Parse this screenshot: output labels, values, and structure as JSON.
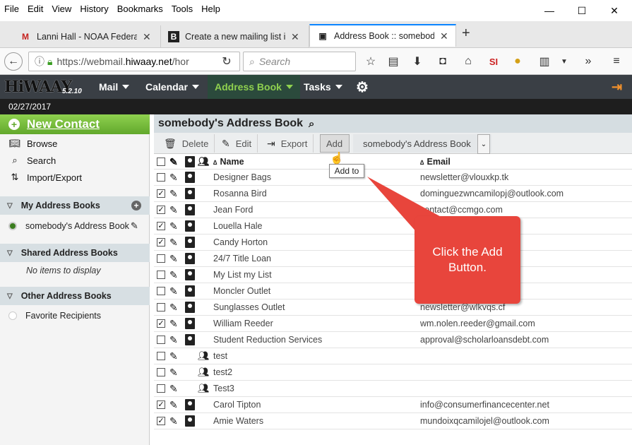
{
  "menubar": [
    "File",
    "Edit",
    "View",
    "History",
    "Bookmarks",
    "Tools",
    "Help"
  ],
  "window_controls": [
    "—",
    "☐",
    "✕"
  ],
  "tabs": [
    {
      "favicon": "M",
      "favicon_color": "#c5221f",
      "title": "Lanni Hall - NOAA Federal..."
    },
    {
      "favicon": "B",
      "favicon_color": "#222222",
      "title": "Create a new mailing list i..."
    },
    {
      "favicon": "▣",
      "favicon_color": "#333333",
      "title": "Address Book :: somebod..."
    }
  ],
  "new_tab": "+",
  "nav": {
    "url": "https://webmail.hiwaay.net/hor",
    "url_plain": "https://webmail.",
    "url_strong": "hiwaay.net",
    "url_rest": "/hor",
    "search_placeholder": "Search"
  },
  "app": {
    "logo": "HiWAAY",
    "version": "5.2.10",
    "nav": [
      "Mail",
      "Calendar",
      "Address Book",
      "Tasks"
    ],
    "date": "02/27/2017"
  },
  "sidebar": {
    "new_contact": "New Contact",
    "links": [
      "Browse",
      "Search",
      "Import/Export"
    ],
    "my_books": "My Address Books",
    "my_book_item": "somebody's Address Book",
    "shared_books": "Shared Address Books",
    "shared_empty": "No items to display",
    "other_books": "Other Address Books",
    "other_item": "Favorite Recipients"
  },
  "main": {
    "title": "somebody's Address Book",
    "toolbar": {
      "delete": "Delete",
      "edit": "Edit",
      "export": "Export",
      "add": "Add",
      "book_select": "somebody's Address Book"
    },
    "columns": {
      "name": "Name",
      "email": "Email",
      "sort_glyph": "∆"
    },
    "rows": [
      {
        "checked": false,
        "type": "contact",
        "name": "Designer Bags",
        "email": "newsletter@vlouxkp.tk"
      },
      {
        "checked": true,
        "type": "contact",
        "name": "Rosanna Bird",
        "email": "dominguezwncamilopj@outlook.com"
      },
      {
        "checked": true,
        "type": "contact",
        "name": "Jean Ford",
        "email": "contact@ccmgo.com"
      },
      {
        "checked": true,
        "type": "contact",
        "name": "Louella Hale",
        "email": "com"
      },
      {
        "checked": true,
        "type": "contact",
        "name": "Candy Horton",
        "email": "outlook.com"
      },
      {
        "checked": false,
        "type": "contact",
        "name": "24/7 Title Loan",
        "email": ""
      },
      {
        "checked": false,
        "type": "contact",
        "name": "My List my List",
        "email": ""
      },
      {
        "checked": false,
        "type": "contact",
        "name": "Moncler Outlet",
        "email": ""
      },
      {
        "checked": false,
        "type": "contact",
        "name": "Sunglasses Outlet",
        "email": "newsletter@wlkvqs.cf"
      },
      {
        "checked": true,
        "type": "contact",
        "name": "William Reeder",
        "email": "wm.nolen.reeder@gmail.com"
      },
      {
        "checked": false,
        "type": "contact",
        "name": "Student Reduction Services",
        "email": "approval@scholarloansdebt.com"
      },
      {
        "checked": false,
        "type": "group",
        "name": "test",
        "email": ""
      },
      {
        "checked": false,
        "type": "group",
        "name": "test2",
        "email": ""
      },
      {
        "checked": false,
        "type": "group",
        "name": "Test3",
        "email": ""
      },
      {
        "checked": true,
        "type": "contact",
        "name": "Carol Tipton",
        "email": "info@consumerfinancecenter.net"
      },
      {
        "checked": true,
        "type": "contact",
        "name": "Amie Waters",
        "email": "mundoixqcamilojel@outlook.com"
      }
    ]
  },
  "tooltip": "Add to",
  "callout": "Click the Add Button.",
  "colors": {
    "accent_green": "#8fd14f",
    "callout_red": "#e8453c",
    "app_bar": "#3a3f45"
  }
}
